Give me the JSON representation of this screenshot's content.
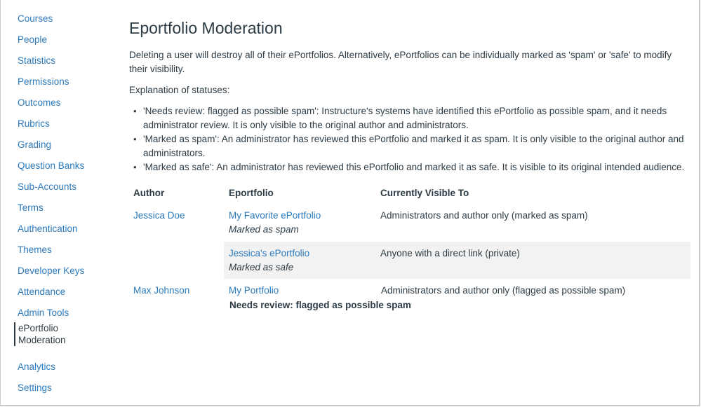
{
  "sidebar": {
    "items": [
      {
        "label": "Courses"
      },
      {
        "label": "People"
      },
      {
        "label": "Statistics"
      },
      {
        "label": "Permissions"
      },
      {
        "label": "Outcomes"
      },
      {
        "label": "Rubrics"
      },
      {
        "label": "Grading"
      },
      {
        "label": "Question Banks"
      },
      {
        "label": "Sub-Accounts"
      },
      {
        "label": "Terms"
      },
      {
        "label": "Authentication"
      },
      {
        "label": "Themes"
      },
      {
        "label": "Developer Keys"
      },
      {
        "label": "Attendance"
      },
      {
        "label": "Admin Tools"
      },
      {
        "label": "ePortfolio Moderation",
        "active": true
      },
      {
        "label": "Analytics"
      },
      {
        "label": "Settings"
      }
    ]
  },
  "main": {
    "title": "Eportfolio Moderation",
    "intro": "Deleting a user will destroy all of their ePortfolios. Alternatively, ePortfolios can be individually marked as 'spam' or 'safe' to modify their visibility.",
    "explanation_heading": "Explanation of statuses:",
    "statuses": [
      "'Needs review: flagged as possible spam': Instructure's systems have identified this ePortfolio as possible spam, and it needs administrator review. It is only visible to the original author and administrators.",
      "'Marked as spam': An administrator has reviewed this ePortfolio and marked it as spam. It is only visible to the original author and administrators.",
      "'Marked as safe': An administrator has reviewed this ePortfolio and marked it as safe. It is visible to its original intended audience."
    ],
    "table": {
      "headers": [
        "Author",
        "Eportfolio",
        "Currently Visible To"
      ],
      "rows": [
        {
          "author": "Jessica Doe",
          "eportfolio": "My Favorite ePortfolio",
          "status": "Marked as spam",
          "visible_to": "Administrators and author only (marked as spam)"
        },
        {
          "author": "",
          "eportfolio": "Jessica's ePortfolio",
          "status": "Marked as safe",
          "visible_to": "Anyone with a direct link (private)"
        },
        {
          "author": "Max Johnson",
          "eportfolio": "My Portfolio",
          "status": "Needs review: flagged as possible spam",
          "visible_to": "Administrators and author only (flagged as possible spam)"
        }
      ]
    }
  }
}
